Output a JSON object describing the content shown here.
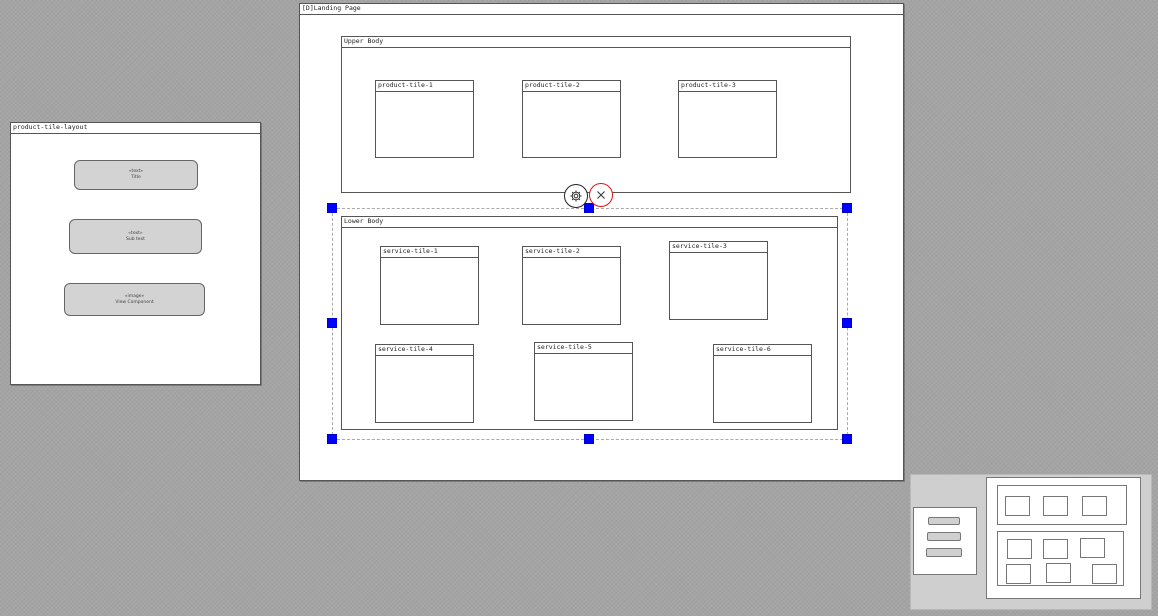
{
  "layout_frame": {
    "title": "product-tile-layout",
    "items": [
      {
        "stereotype": "«text»",
        "label": "Title"
      },
      {
        "stereotype": "«text»",
        "label": "Sub text"
      },
      {
        "stereotype": "«image»",
        "label": "View Component"
      }
    ]
  },
  "page_frame": {
    "title": "[D]Landing Page",
    "upper_body": {
      "title": "Upper Body",
      "tiles": [
        "product-tile-1",
        "product-tile-2",
        "product-tile-3"
      ]
    },
    "lower_body": {
      "title": "Lower Body",
      "tiles": [
        "service-tile-1",
        "service-tile-2",
        "service-tile-3",
        "service-tile-4",
        "service-tile-5",
        "service-tile-6"
      ]
    }
  },
  "selection_controls": {
    "settings_icon": "gear-icon",
    "delete_icon": "close-icon",
    "delete_color": "#e01010",
    "handle_color": "#0000ff"
  },
  "colors": {
    "canvas": "#a4a4a4",
    "frame_bg": "#ffffff",
    "pill_bg": "#d3d3d3"
  }
}
